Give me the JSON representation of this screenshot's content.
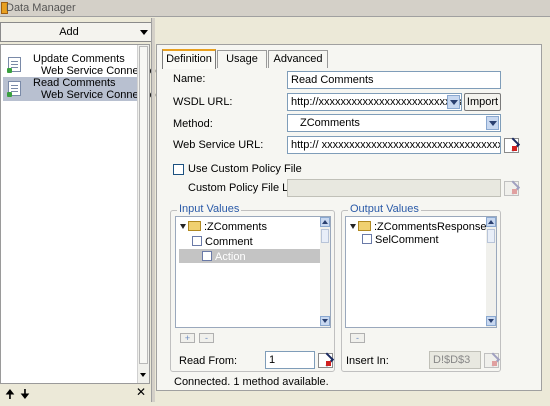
{
  "window": {
    "title": "Data Manager"
  },
  "left": {
    "add_label": "Add",
    "items": [
      {
        "title": "Update Comments",
        "subtitle": "Web Service Connection",
        "selected": false
      },
      {
        "title": "Read Comments",
        "subtitle": "Web Service Connection",
        "selected": true
      }
    ],
    "bottom": {
      "up": "🠉",
      "down": "🠋",
      "close": "✕"
    }
  },
  "tabs": [
    "Definition",
    "Usage",
    "Advanced"
  ],
  "form": {
    "name_label": "Name:",
    "name_value": "Read Comments",
    "wsdl_label": "WSDL URL:",
    "wsdl_value": "http://xxxxxxxxxxxxxxxxxxxxxxxxx   ap/bc/",
    "import_label": "Import",
    "method_label": "Method:",
    "method_value": "ZComments",
    "ws_url_label": "Web Service URL:",
    "ws_url_value": "http://   xxxxxxxxxxxxxxxxxxxxxxxxxxxxxxxxxxxxxxxx",
    "use_policy_label": "Use Custom Policy File",
    "policy_location_label": "Custom Policy File Location:",
    "policy_location_value": ""
  },
  "input_values": {
    "legend": "Input Values",
    "nodes": [
      ":ZComments",
      "Comment",
      "Action"
    ],
    "add": "+",
    "remove": "-",
    "read_from_label": "Read From:",
    "read_from_value": "1"
  },
  "output_values": {
    "legend": "Output Values",
    "nodes": [
      ":ZCommentsResponse",
      "SelComment"
    ],
    "remove": "-",
    "insert_in_label": "Insert In:",
    "insert_in_value": "D!$D$3"
  },
  "status": "Connected. 1 method available.",
  "colors": {
    "selection": "#b8c0d0",
    "tab_accent": "#e8a020",
    "legend": "#2a5aa8"
  }
}
